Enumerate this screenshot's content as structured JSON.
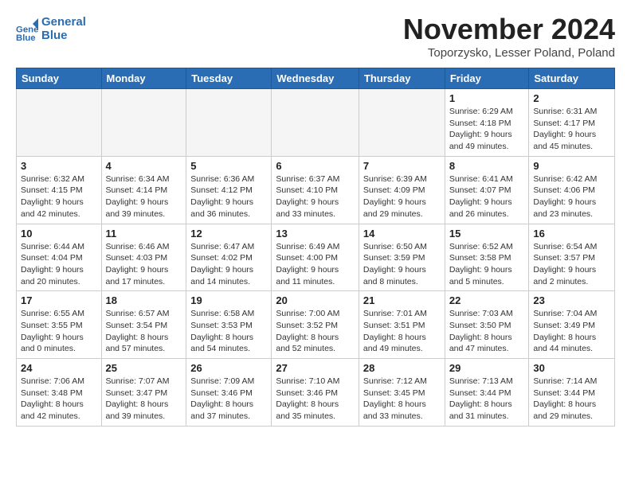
{
  "app": {
    "logo_line1": "General",
    "logo_line2": "Blue"
  },
  "header": {
    "month_year": "November 2024",
    "location": "Toporzysko, Lesser Poland, Poland"
  },
  "weekdays": [
    "Sunday",
    "Monday",
    "Tuesday",
    "Wednesday",
    "Thursday",
    "Friday",
    "Saturday"
  ],
  "weeks": [
    [
      {
        "day": "",
        "info": ""
      },
      {
        "day": "",
        "info": ""
      },
      {
        "day": "",
        "info": ""
      },
      {
        "day": "",
        "info": ""
      },
      {
        "day": "",
        "info": ""
      },
      {
        "day": "1",
        "info": "Sunrise: 6:29 AM\nSunset: 4:18 PM\nDaylight: 9 hours\nand 49 minutes."
      },
      {
        "day": "2",
        "info": "Sunrise: 6:31 AM\nSunset: 4:17 PM\nDaylight: 9 hours\nand 45 minutes."
      }
    ],
    [
      {
        "day": "3",
        "info": "Sunrise: 6:32 AM\nSunset: 4:15 PM\nDaylight: 9 hours\nand 42 minutes."
      },
      {
        "day": "4",
        "info": "Sunrise: 6:34 AM\nSunset: 4:14 PM\nDaylight: 9 hours\nand 39 minutes."
      },
      {
        "day": "5",
        "info": "Sunrise: 6:36 AM\nSunset: 4:12 PM\nDaylight: 9 hours\nand 36 minutes."
      },
      {
        "day": "6",
        "info": "Sunrise: 6:37 AM\nSunset: 4:10 PM\nDaylight: 9 hours\nand 33 minutes."
      },
      {
        "day": "7",
        "info": "Sunrise: 6:39 AM\nSunset: 4:09 PM\nDaylight: 9 hours\nand 29 minutes."
      },
      {
        "day": "8",
        "info": "Sunrise: 6:41 AM\nSunset: 4:07 PM\nDaylight: 9 hours\nand 26 minutes."
      },
      {
        "day": "9",
        "info": "Sunrise: 6:42 AM\nSunset: 4:06 PM\nDaylight: 9 hours\nand 23 minutes."
      }
    ],
    [
      {
        "day": "10",
        "info": "Sunrise: 6:44 AM\nSunset: 4:04 PM\nDaylight: 9 hours\nand 20 minutes."
      },
      {
        "day": "11",
        "info": "Sunrise: 6:46 AM\nSunset: 4:03 PM\nDaylight: 9 hours\nand 17 minutes."
      },
      {
        "day": "12",
        "info": "Sunrise: 6:47 AM\nSunset: 4:02 PM\nDaylight: 9 hours\nand 14 minutes."
      },
      {
        "day": "13",
        "info": "Sunrise: 6:49 AM\nSunset: 4:00 PM\nDaylight: 9 hours\nand 11 minutes."
      },
      {
        "day": "14",
        "info": "Sunrise: 6:50 AM\nSunset: 3:59 PM\nDaylight: 9 hours\nand 8 minutes."
      },
      {
        "day": "15",
        "info": "Sunrise: 6:52 AM\nSunset: 3:58 PM\nDaylight: 9 hours\nand 5 minutes."
      },
      {
        "day": "16",
        "info": "Sunrise: 6:54 AM\nSunset: 3:57 PM\nDaylight: 9 hours\nand 2 minutes."
      }
    ],
    [
      {
        "day": "17",
        "info": "Sunrise: 6:55 AM\nSunset: 3:55 PM\nDaylight: 9 hours\nand 0 minutes."
      },
      {
        "day": "18",
        "info": "Sunrise: 6:57 AM\nSunset: 3:54 PM\nDaylight: 8 hours\nand 57 minutes."
      },
      {
        "day": "19",
        "info": "Sunrise: 6:58 AM\nSunset: 3:53 PM\nDaylight: 8 hours\nand 54 minutes."
      },
      {
        "day": "20",
        "info": "Sunrise: 7:00 AM\nSunset: 3:52 PM\nDaylight: 8 hours\nand 52 minutes."
      },
      {
        "day": "21",
        "info": "Sunrise: 7:01 AM\nSunset: 3:51 PM\nDaylight: 8 hours\nand 49 minutes."
      },
      {
        "day": "22",
        "info": "Sunrise: 7:03 AM\nSunset: 3:50 PM\nDaylight: 8 hours\nand 47 minutes."
      },
      {
        "day": "23",
        "info": "Sunrise: 7:04 AM\nSunset: 3:49 PM\nDaylight: 8 hours\nand 44 minutes."
      }
    ],
    [
      {
        "day": "24",
        "info": "Sunrise: 7:06 AM\nSunset: 3:48 PM\nDaylight: 8 hours\nand 42 minutes."
      },
      {
        "day": "25",
        "info": "Sunrise: 7:07 AM\nSunset: 3:47 PM\nDaylight: 8 hours\nand 39 minutes."
      },
      {
        "day": "26",
        "info": "Sunrise: 7:09 AM\nSunset: 3:46 PM\nDaylight: 8 hours\nand 37 minutes."
      },
      {
        "day": "27",
        "info": "Sunrise: 7:10 AM\nSunset: 3:46 PM\nDaylight: 8 hours\nand 35 minutes."
      },
      {
        "day": "28",
        "info": "Sunrise: 7:12 AM\nSunset: 3:45 PM\nDaylight: 8 hours\nand 33 minutes."
      },
      {
        "day": "29",
        "info": "Sunrise: 7:13 AM\nSunset: 3:44 PM\nDaylight: 8 hours\nand 31 minutes."
      },
      {
        "day": "30",
        "info": "Sunrise: 7:14 AM\nSunset: 3:44 PM\nDaylight: 8 hours\nand 29 minutes."
      }
    ]
  ]
}
